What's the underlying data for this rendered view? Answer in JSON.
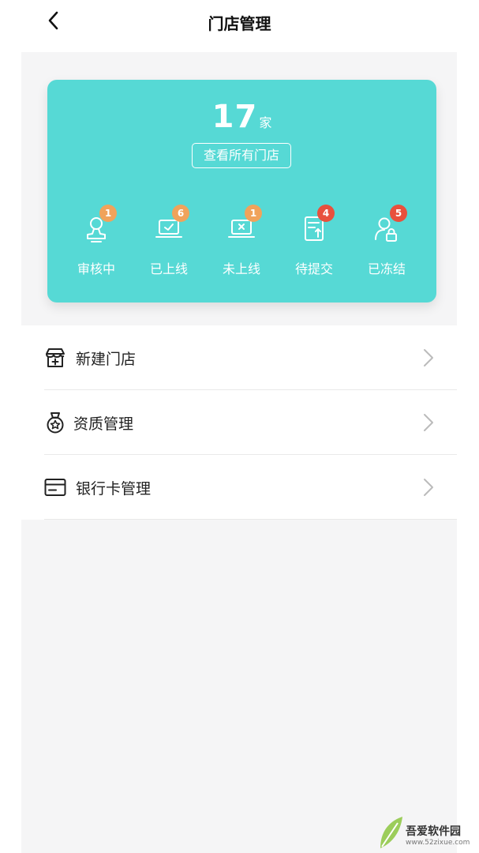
{
  "header": {
    "title": "门店管理"
  },
  "summary": {
    "count": "17",
    "unit": "家",
    "view_all_label": "查看所有门店"
  },
  "statuses": [
    {
      "label": "审核中",
      "badge": "1",
      "badge_color": "#f0a35b",
      "icon": "user-review-icon"
    },
    {
      "label": "已上线",
      "badge": "6",
      "badge_color": "#f0a35b",
      "icon": "laptop-check-icon"
    },
    {
      "label": "未上线",
      "badge": "1",
      "badge_color": "#f0a35b",
      "icon": "laptop-x-icon"
    },
    {
      "label": "待提交",
      "badge": "4",
      "badge_color": "#e8513d",
      "icon": "document-upload-icon"
    },
    {
      "label": "已冻结",
      "badge": "5",
      "badge_color": "#e8513d",
      "icon": "user-lock-icon"
    }
  ],
  "menu": [
    {
      "label": "新建门店",
      "icon": "store-add-icon"
    },
    {
      "label": "资质管理",
      "icon": "medal-star-icon"
    },
    {
      "label": "银行卡管理",
      "icon": "bank-card-icon"
    }
  ],
  "watermark": {
    "line1": "吾爱软件园",
    "line2": "www.52zixue.com"
  },
  "colors": {
    "card": "#56d9d5",
    "panel": "#f5f5f6",
    "text": "#222222"
  }
}
